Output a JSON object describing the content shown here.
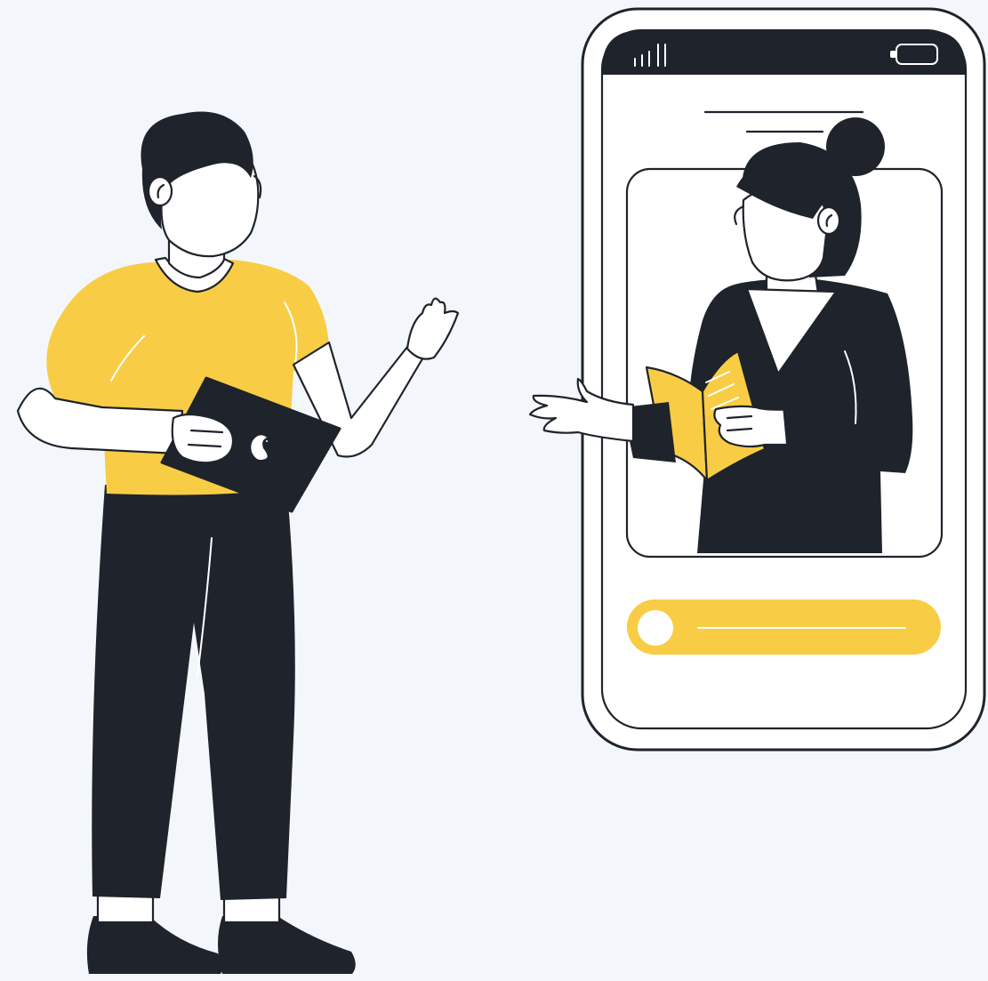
{
  "colors": {
    "background": "#f3f7fb",
    "ink": "#1f232b",
    "accent": "#f8cd45",
    "paper": "#ffffff"
  },
  "icons": {
    "signal": "signal-bars-icon",
    "battery": "battery-icon",
    "laptop_logo": "apple-logo-icon"
  },
  "phone": {
    "call_slider_level": 0.1
  }
}
